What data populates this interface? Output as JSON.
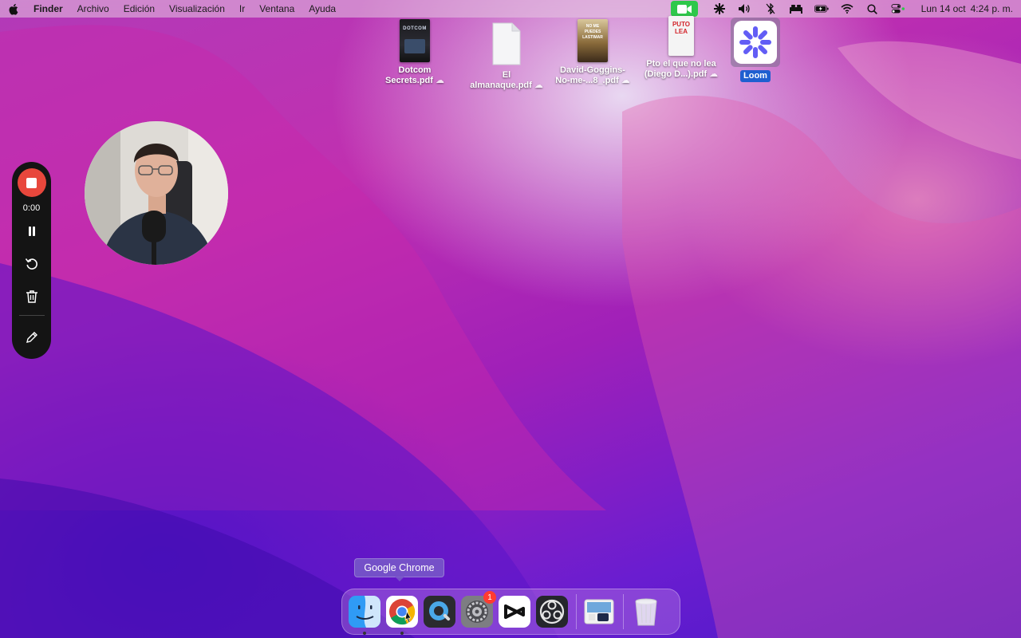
{
  "menubar": {
    "app_name": "Finder",
    "menus": [
      "Archivo",
      "Edición",
      "Visualización",
      "Ir",
      "Ventana",
      "Ayuda"
    ],
    "clock_date": "Lun 14 oct",
    "clock_time": "4:24 p. m."
  },
  "desktop_icons": [
    {
      "line1": "Dotcom",
      "line2": "Secrets.pdf"
    },
    {
      "line1": "El",
      "line2": "almanaque.pdf"
    },
    {
      "line1": "David-Goggins-",
      "line2": "No-me-...8_.pdf"
    },
    {
      "line1": "Pto el que no lea",
      "line2": "(Diego D...).pdf"
    },
    {
      "line1": "Loom"
    }
  ],
  "book_covers": {
    "dotcom": "DOTCOM",
    "goggins": "NO ME PUEDES LASTIMAR",
    "puto": "PUTO LEA"
  },
  "recorder": {
    "timer": "0:00"
  },
  "tooltip": "Google Chrome",
  "dock": {
    "settings_badge": "1"
  },
  "colors": {
    "record_red": "#e8473c",
    "loom_blue": "#625df5",
    "facetime_green": "#2ec84a",
    "selection_blue": "#1f5fd0"
  }
}
